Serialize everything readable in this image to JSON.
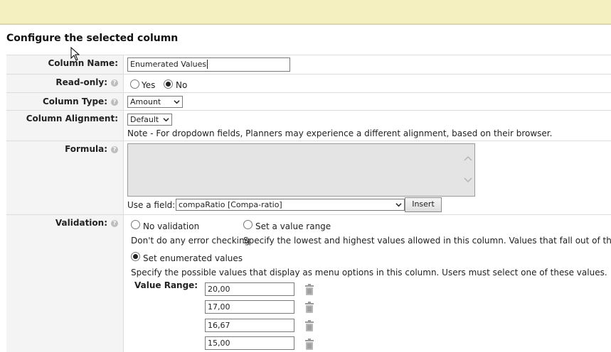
{
  "header": {
    "title": "Configure the selected column"
  },
  "form": {
    "column_name": {
      "label": "Column Name:",
      "value": "Enumerated Values"
    },
    "read_only": {
      "label": "Read-only:",
      "options": [
        "Yes",
        "No"
      ],
      "selected": "No"
    },
    "column_type": {
      "label": "Column Type:",
      "value": "Amount"
    },
    "column_alignment": {
      "label": "Column Alignment:",
      "value": "Default",
      "note": "Note - For dropdown fields, Planners may experience a different alignment, based on their browser."
    },
    "formula": {
      "label": "Formula:",
      "value": "",
      "field_label": "Use a field:",
      "field_value": "compaRatio [Compa-ratio]",
      "insert_label": "Insert"
    },
    "validation": {
      "label": "Validation:",
      "options": [
        {
          "label": "No validation",
          "description": "Don't do any error checking",
          "selected": false
        },
        {
          "label": "Set a value range",
          "description": "Specify the lowest and highest values allowed in this column. Values that fall out of this ran",
          "selected": false
        },
        {
          "label": "Set enumerated values",
          "description": "Specify the possible values that display as menu options in this column. Users must select one of these values.",
          "selected": true
        }
      ],
      "value_range_label": "Value Range:",
      "values": [
        "20,00",
        "17,00",
        "16,67",
        "15,00"
      ]
    }
  },
  "icons": {
    "help": "help-icon",
    "delete": "trash-icon",
    "dropdown": "chevron-down-icon"
  },
  "colors": {
    "topbar": "#f5f0c0",
    "label_column": "#f4f4f4",
    "formula_bg": "#e4e4e4"
  }
}
